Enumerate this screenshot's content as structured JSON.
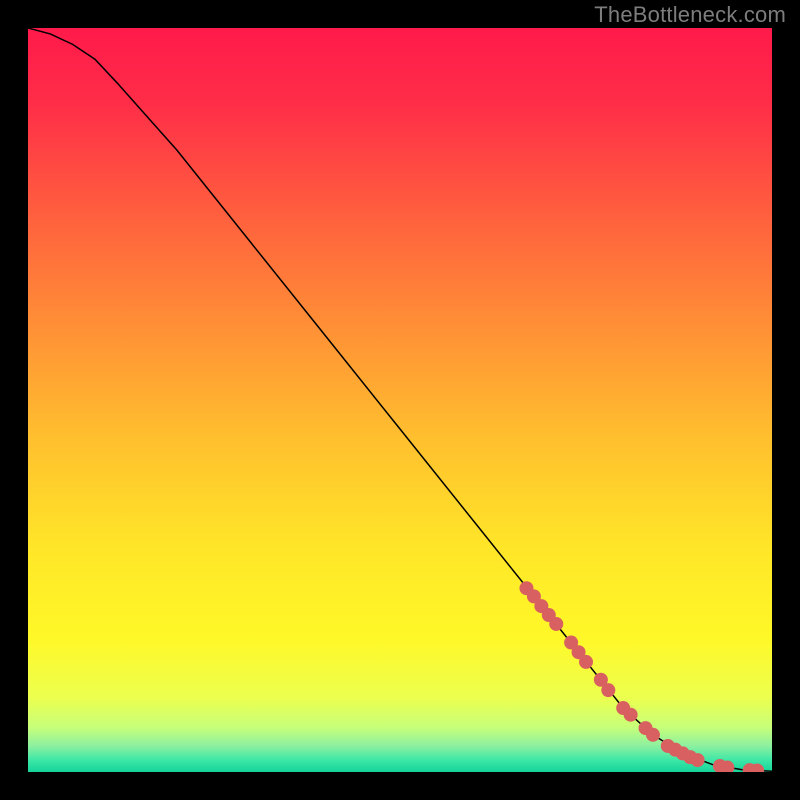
{
  "attribution": "TheBottleneck.com",
  "chart_data": {
    "type": "line",
    "title": "",
    "xlabel": "",
    "ylabel": "",
    "xlim": [
      0,
      100
    ],
    "ylim": [
      0,
      100
    ],
    "grid": false,
    "legend": false,
    "background_gradient": {
      "stops": [
        {
          "pos": 0.0,
          "color": "#ff1a4a"
        },
        {
          "pos": 0.1,
          "color": "#ff2d48"
        },
        {
          "pos": 0.25,
          "color": "#ff5f3e"
        },
        {
          "pos": 0.4,
          "color": "#ff8f36"
        },
        {
          "pos": 0.55,
          "color": "#ffbf2e"
        },
        {
          "pos": 0.7,
          "color": "#ffe628"
        },
        {
          "pos": 0.82,
          "color": "#fff828"
        },
        {
          "pos": 0.9,
          "color": "#ecff4e"
        },
        {
          "pos": 0.94,
          "color": "#c7ff7a"
        },
        {
          "pos": 0.965,
          "color": "#8cf0a0"
        },
        {
          "pos": 0.985,
          "color": "#39e6a6"
        },
        {
          "pos": 1.0,
          "color": "#15d49a"
        }
      ]
    },
    "series": [
      {
        "name": "curve",
        "color": "#000000",
        "x": [
          0,
          3,
          6,
          9,
          12,
          20,
          30,
          40,
          50,
          60,
          70,
          76,
          80,
          84,
          88,
          92,
          96,
          100
        ],
        "y": [
          100,
          99.2,
          97.8,
          95.8,
          92.6,
          83.6,
          71.1,
          58.6,
          46.1,
          33.6,
          21.1,
          13.6,
          8.6,
          5.0,
          2.5,
          1.0,
          0.3,
          0.1
        ]
      }
    ],
    "markers": {
      "name": "highlight-dots",
      "color": "#d96060",
      "radius_px": 7,
      "x": [
        67,
        68,
        69,
        70,
        71,
        73,
        74,
        75,
        77,
        78,
        80,
        81,
        83,
        84,
        86,
        87,
        88,
        89,
        90,
        93,
        94,
        97,
        98
      ],
      "y": [
        24.7,
        23.6,
        22.3,
        21.1,
        19.9,
        17.4,
        16.1,
        14.8,
        12.4,
        11.0,
        8.6,
        7.7,
        5.9,
        5.0,
        3.5,
        3.0,
        2.5,
        2.0,
        1.6,
        0.8,
        0.6,
        0.25,
        0.2
      ]
    }
  }
}
